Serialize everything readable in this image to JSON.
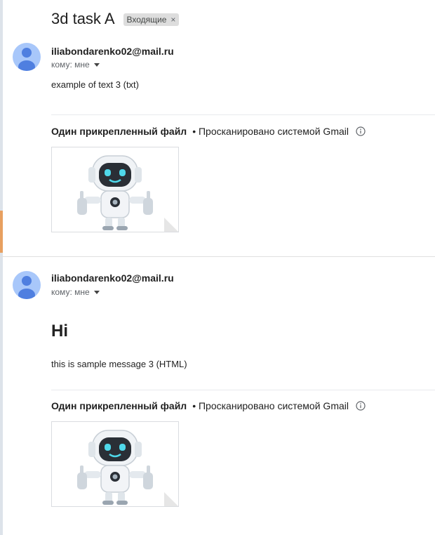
{
  "subject": "3d task A",
  "label": {
    "text": "Входящие",
    "close": "×"
  },
  "messages": [
    {
      "sender": "iliabondarenko02@mail.ru",
      "recipient": "кому: мне",
      "heading": "",
      "body": "example of text 3 (txt)",
      "attachment_title": "Один прикрепленный файл",
      "scan_note": "• Просканировано системой Gmail"
    },
    {
      "sender": "iliabondarenko02@mail.ru",
      "recipient": "кому: мне",
      "heading": "Hi",
      "body": "this is sample message 3 (HTML)",
      "attachment_title": "Один прикрепленный файл",
      "scan_note": "• Просканировано системой Gmail"
    }
  ],
  "icons": {
    "avatar": "person-icon",
    "dropdown": "caret-down-icon",
    "info": "info-icon",
    "attachment": "robot-image-thumbnail"
  }
}
